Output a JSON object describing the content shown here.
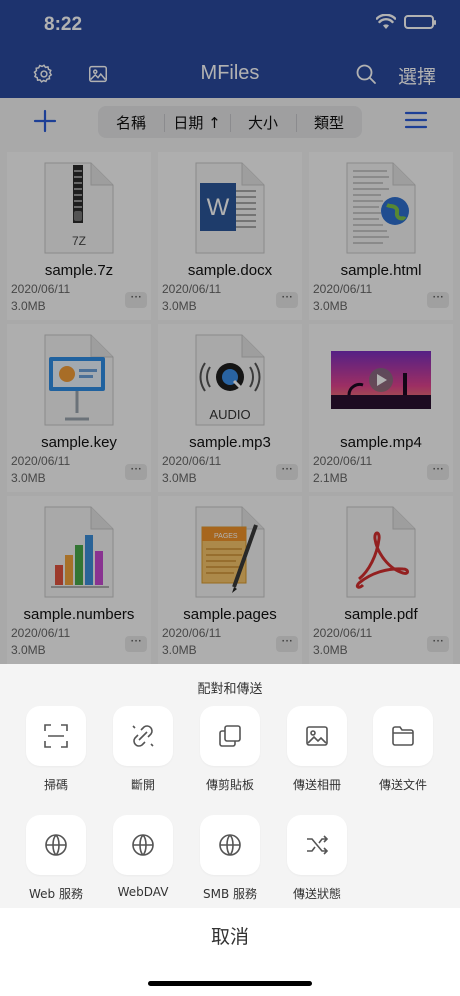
{
  "status_bar": {
    "time": "8:22"
  },
  "nav": {
    "title": "MFiles",
    "select_label": "選擇"
  },
  "toolbar": {
    "sort_options": [
      "名稱",
      "日期 ↑",
      "大小",
      "類型"
    ]
  },
  "files": [
    {
      "name": "sample.7z",
      "date": "2020/06/11",
      "size": "3.0MB",
      "badge": "7Z",
      "more": "···"
    },
    {
      "name": "sample.docx",
      "date": "2020/06/11",
      "size": "3.0MB",
      "badge": "W",
      "more": "···"
    },
    {
      "name": "sample.html",
      "date": "2020/06/11",
      "size": "3.0MB",
      "badge": "",
      "more": "···"
    },
    {
      "name": "sample.key",
      "date": "2020/06/11",
      "size": "3.0MB",
      "badge": "",
      "more": "···"
    },
    {
      "name": "sample.mp3",
      "date": "2020/06/11",
      "size": "3.0MB",
      "badge": "AUDIO",
      "more": "···"
    },
    {
      "name": "sample.mp4",
      "date": "2020/06/11",
      "size": "2.1MB",
      "badge": "",
      "more": "···"
    },
    {
      "name": "sample.numbers",
      "date": "2020/06/11",
      "size": "3.0MB",
      "badge": "",
      "more": "···"
    },
    {
      "name": "sample.pages",
      "date": "2020/06/11",
      "size": "3.0MB",
      "badge": "PAGES",
      "more": "···"
    },
    {
      "name": "sample.pdf",
      "date": "2020/06/11",
      "size": "3.0MB",
      "badge": "",
      "more": "···"
    }
  ],
  "sheet": {
    "title": "配對和傳送",
    "actions": [
      {
        "label": "掃碼",
        "icon": "scan-icon"
      },
      {
        "label": "斷開",
        "icon": "unlink-icon"
      },
      {
        "label": "傳剪貼板",
        "icon": "clipboard-icon"
      },
      {
        "label": "傳送相冊",
        "icon": "photo-icon"
      },
      {
        "label": "傳送文件",
        "icon": "folder-icon"
      },
      {
        "label": "Web 服務",
        "icon": "globe-icon"
      },
      {
        "label": "WebDAV",
        "icon": "globe-icon"
      },
      {
        "label": "SMB 服務",
        "icon": "globe-icon"
      },
      {
        "label": "傳送狀態",
        "icon": "shuffle-icon"
      }
    ],
    "cancel_label": "取消"
  },
  "colors": {
    "header": "#2a4a9e",
    "accent": "#2a5bd7"
  }
}
